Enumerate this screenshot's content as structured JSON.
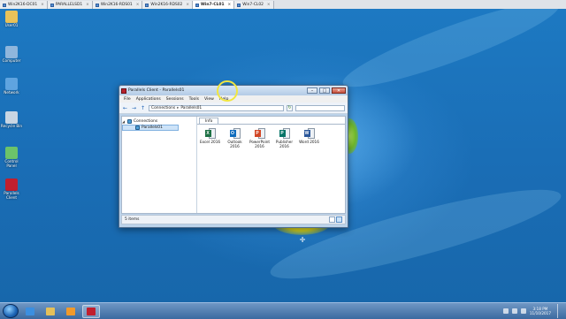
{
  "vm_tabs": [
    {
      "label": "Win2K16-DC01",
      "active": false
    },
    {
      "label": "PARALLELSD1",
      "active": false
    },
    {
      "label": "Win2K16-RDS01",
      "active": false
    },
    {
      "label": "Win2K16-RDS02",
      "active": false
    },
    {
      "label": "Win7-CL01",
      "active": true
    },
    {
      "label": "Win7-CL02",
      "active": false
    }
  ],
  "desktop_icons": [
    {
      "label": "User01",
      "icon": "folder-icon",
      "color": "#e8c25a"
    },
    {
      "label": "Computer",
      "icon": "computer-icon",
      "color": "#8fb6dc"
    },
    {
      "label": "Network",
      "icon": "network-icon",
      "color": "#5fa4e0"
    },
    {
      "label": "Recycle Bin",
      "icon": "recycle-bin-icon",
      "color": "#c9d6e3"
    },
    {
      "label": "Control Panel",
      "icon": "control-panel-icon",
      "color": "#6cc36a"
    },
    {
      "label": "Parallels Client",
      "icon": "parallels-client-icon",
      "color": "#c01f2e"
    }
  ],
  "window": {
    "title": "Parallels Client - Parallels01",
    "menu": [
      "File",
      "Applications",
      "Sessions",
      "Tools",
      "View",
      "Help"
    ],
    "address": {
      "root": "Connections",
      "current": "Parallels01"
    },
    "tree": {
      "root": "Connections",
      "child": "Parallels01"
    },
    "tab": "Info",
    "apps": [
      {
        "name": "Excel 2016",
        "letter": "X",
        "color": "#1e7145",
        "icon": "excel-icon"
      },
      {
        "name": "Outlook 2016",
        "letter": "O",
        "color": "#0f6cbd",
        "icon": "outlook-icon"
      },
      {
        "name": "PowerPoint 2016",
        "letter": "P",
        "color": "#d24726",
        "icon": "powerpoint-icon"
      },
      {
        "name": "Publisher 2016",
        "letter": "P",
        "color": "#077568",
        "icon": "publisher-icon"
      },
      {
        "name": "Word 2016",
        "letter": "W",
        "color": "#2b579a",
        "icon": "word-icon"
      }
    ],
    "status": "5 items"
  },
  "taskbar": {
    "pinned": [
      {
        "icon": "internet-explorer-icon",
        "color": "#3b8fe0",
        "active": false
      },
      {
        "icon": "file-explorer-icon",
        "color": "#e4c05a",
        "active": false
      },
      {
        "icon": "media-player-icon",
        "color": "#f19a2b",
        "active": false
      },
      {
        "icon": "parallels-client-icon",
        "color": "#c01f2e",
        "active": true
      }
    ],
    "time": "3:18 PM",
    "date": "11/10/2017"
  }
}
